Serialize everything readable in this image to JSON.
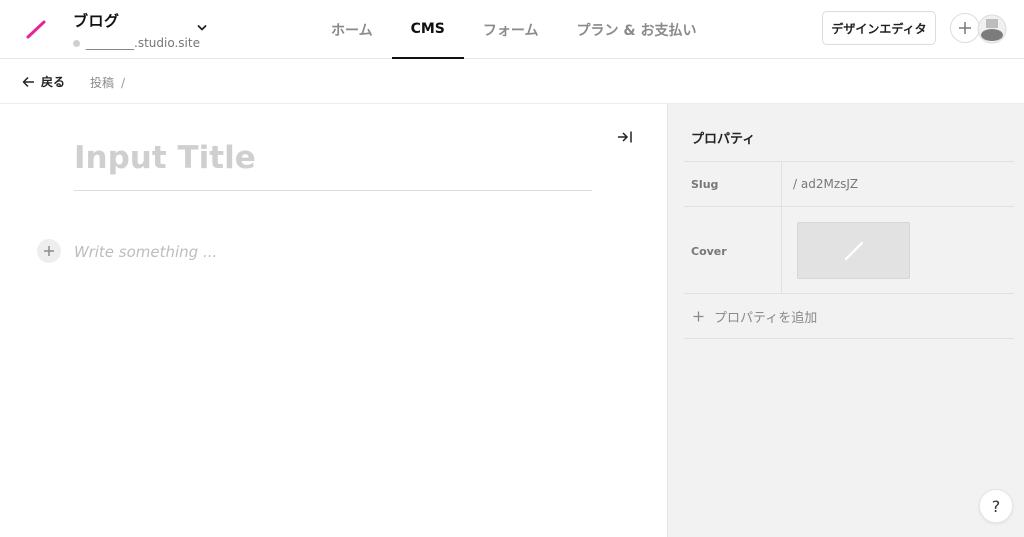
{
  "header": {
    "project_title": "ブログ",
    "project_domain": "________.studio.site",
    "brand_color": "#e8239a",
    "nav_tabs": [
      {
        "label": "ホーム",
        "active": false
      },
      {
        "label": "CMS",
        "active": true
      },
      {
        "label": "フォーム",
        "active": false
      },
      {
        "label": "プラン & お支払い",
        "active": false
      }
    ],
    "design_editor_label": "デザインエディタ"
  },
  "subheader": {
    "back_label": "戻る",
    "breadcrumb": "投稿",
    "breadcrumb_separator": "/"
  },
  "editor": {
    "title_placeholder": "Input Title",
    "body_placeholder": "Write something ..."
  },
  "properties": {
    "title": "プロパティ",
    "slug_label": "Slug",
    "slug_value": "/ ad2MzsJZ",
    "cover_label": "Cover",
    "add_property_label": "プロパティを追加"
  },
  "help": {
    "label": "?"
  },
  "icons": [
    "studio-logo-icon",
    "chevron-down-icon",
    "plus-icon",
    "avatar",
    "arrow-left-icon",
    "collapse-panel-icon",
    "image-placeholder-icon",
    "help-icon"
  ]
}
